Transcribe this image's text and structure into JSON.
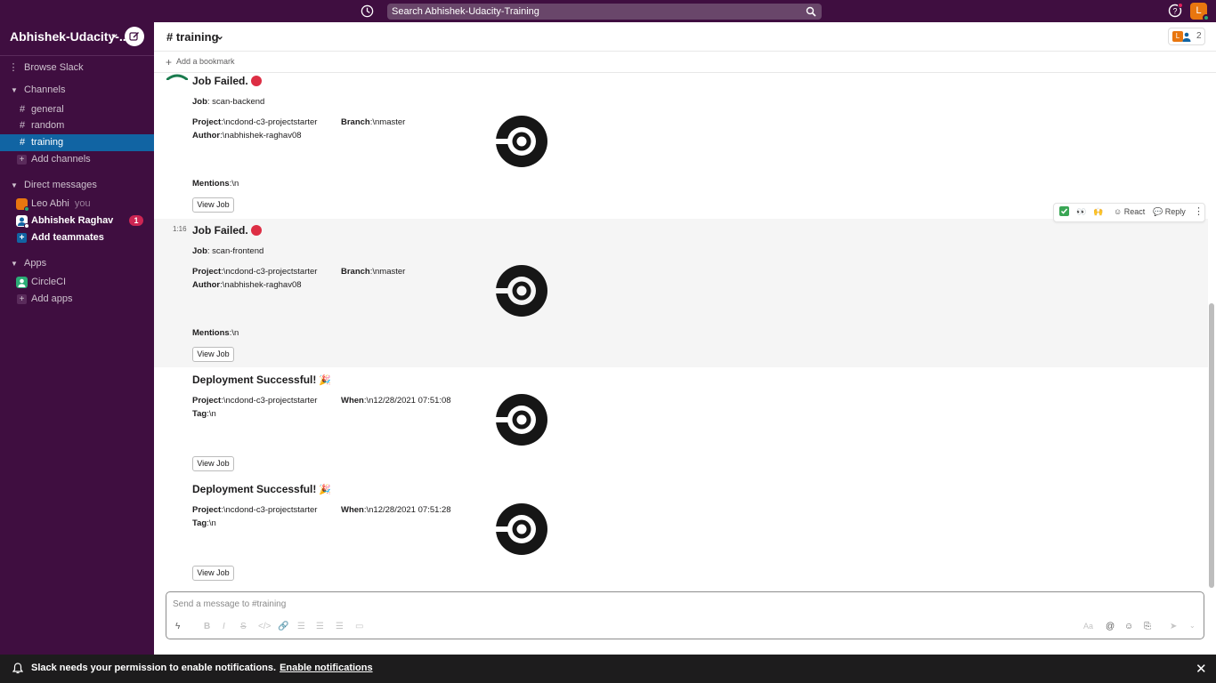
{
  "topbar": {
    "search_placeholder": "Search Abhishek-Udacity-Training",
    "user_initial": "L"
  },
  "sidebar": {
    "workspace": "Abhishek-Udacity-...",
    "browse": "Browse Slack",
    "channels_header": "Channels",
    "channels": [
      "general",
      "random",
      "training"
    ],
    "add_channels": "Add channels",
    "dm_header": "Direct messages",
    "dm_self_name": "Leo Abhi",
    "dm_self_you": "you",
    "dm_other_name": "Abhishek Raghav",
    "dm_other_badge": "1",
    "add_teammates": "Add teammates",
    "apps_header": "Apps",
    "app_circleci": "CircleCI",
    "add_apps": "Add apps"
  },
  "header": {
    "channel": "# training",
    "member_count": "2",
    "add_bookmark": "Add a bookmark",
    "member_initial": "L"
  },
  "messages": [
    {
      "title": "Job Failed.",
      "job_label": "Job",
      "job_value": ": scan-backend",
      "project_label": "Project",
      "project_value": ":\\ncdond-c3-projectstarter",
      "branch_label": "Branch",
      "branch_value": ":\\nmaster",
      "author_label": "Author",
      "author_value": ":\\nabhishek-raghav08",
      "mentions_label": "Mentions",
      "mentions_value": ":\\n",
      "button": "View Job"
    },
    {
      "time": "1:16",
      "title": "Job Failed.",
      "job_label": "Job",
      "job_value": ": scan-frontend",
      "project_label": "Project",
      "project_value": ":\\ncdond-c3-projectstarter",
      "branch_label": "Branch",
      "branch_value": ":\\nmaster",
      "author_label": "Author",
      "author_value": ":\\nabhishek-raghav08",
      "mentions_label": "Mentions",
      "mentions_value": ":\\n",
      "button": "View Job"
    },
    {
      "title": "Deployment Successful!",
      "project_label": "Project",
      "project_value": ":\\ncdond-c3-projectstarter",
      "when_label": "When",
      "when_value": ":\\n12/28/2021 07:51:08",
      "tag_label": "Tag",
      "tag_value": ":\\n",
      "button": "View Job"
    },
    {
      "title": "Deployment Successful!",
      "project_label": "Project",
      "project_value": ":\\ncdond-c3-projectstarter",
      "when_label": "When",
      "when_value": ":\\n12/28/2021 07:51:28",
      "tag_label": "Tag",
      "tag_value": ":\\n",
      "button": "View Job"
    }
  ],
  "hover_toolbar": {
    "react": "React",
    "reply": "Reply"
  },
  "composer": {
    "placeholder": "Send a message to #training"
  },
  "notification": {
    "text": "Slack needs your permission to enable notifications.",
    "link": "Enable notifications"
  },
  "colors": {
    "sidebar_bg": "#3f0e40",
    "active_channel": "#1164a3",
    "badge": "#cd2553",
    "presence": "#2bac76"
  }
}
